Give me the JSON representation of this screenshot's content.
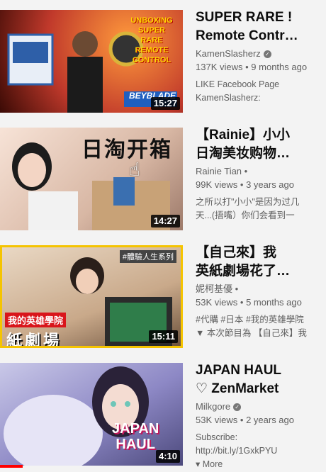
{
  "videos": [
    {
      "title_lines": [
        "SUPER RARE !",
        "Remote Contr…"
      ],
      "channel": "KamenSlasherz",
      "verified": true,
      "views": "137K views",
      "age": "9 months ago",
      "desc_lines": [
        "LIKE Facebook Page",
        "KamenSlasherz:"
      ],
      "duration": "15:27",
      "thumb_text": [
        "UNBOXING",
        "SUPER",
        "RARE",
        "REMOTE",
        "CONTROL"
      ],
      "thumb_logo": "BEYBLADE"
    },
    {
      "title_lines": [
        "【Rainie】小小",
        "日淘美妆购物…"
      ],
      "channel": "Rainie Tian",
      "verified": false,
      "views": "99K views",
      "age": "3 years ago",
      "desc_lines": [
        "之所以打\"小小\"是因为过几",
        "天...(捂嘴）你们会看到一"
      ],
      "duration": "14:27",
      "thumb_text": [
        "日淘开箱"
      ]
    },
    {
      "title_lines": [
        "【自己來】我",
        "英紙劇場花了…"
      ],
      "channel": "妮柯基優",
      "verified": false,
      "views": "53K views",
      "age": "5 months ago",
      "desc_lines": [
        "#代購 #日本 #我的英雄學院",
        "▼ 本次節目為 【自己來】我"
      ],
      "duration": "15:11",
      "thumb_text": [
        "#體驗人生系列",
        "我的英雄學院",
        "紙劇場"
      ]
    },
    {
      "title_lines": [
        "JAPAN HAUL",
        "♡ ZenMarket"
      ],
      "channel": "Milkgore",
      "verified": true,
      "views": "53K views",
      "age": "2 years ago",
      "desc_lines": [
        "Subscribe:",
        "http://bit.ly/1GxkPYU"
      ],
      "more_label": "▾ More",
      "duration": "4:10",
      "thumb_text": [
        "JAPAN",
        "HAUL"
      ]
    }
  ],
  "meta_separator": "•",
  "colors": {
    "progress": "#ff0000",
    "text_secondary": "#606060",
    "background": "#f3f3f3"
  }
}
